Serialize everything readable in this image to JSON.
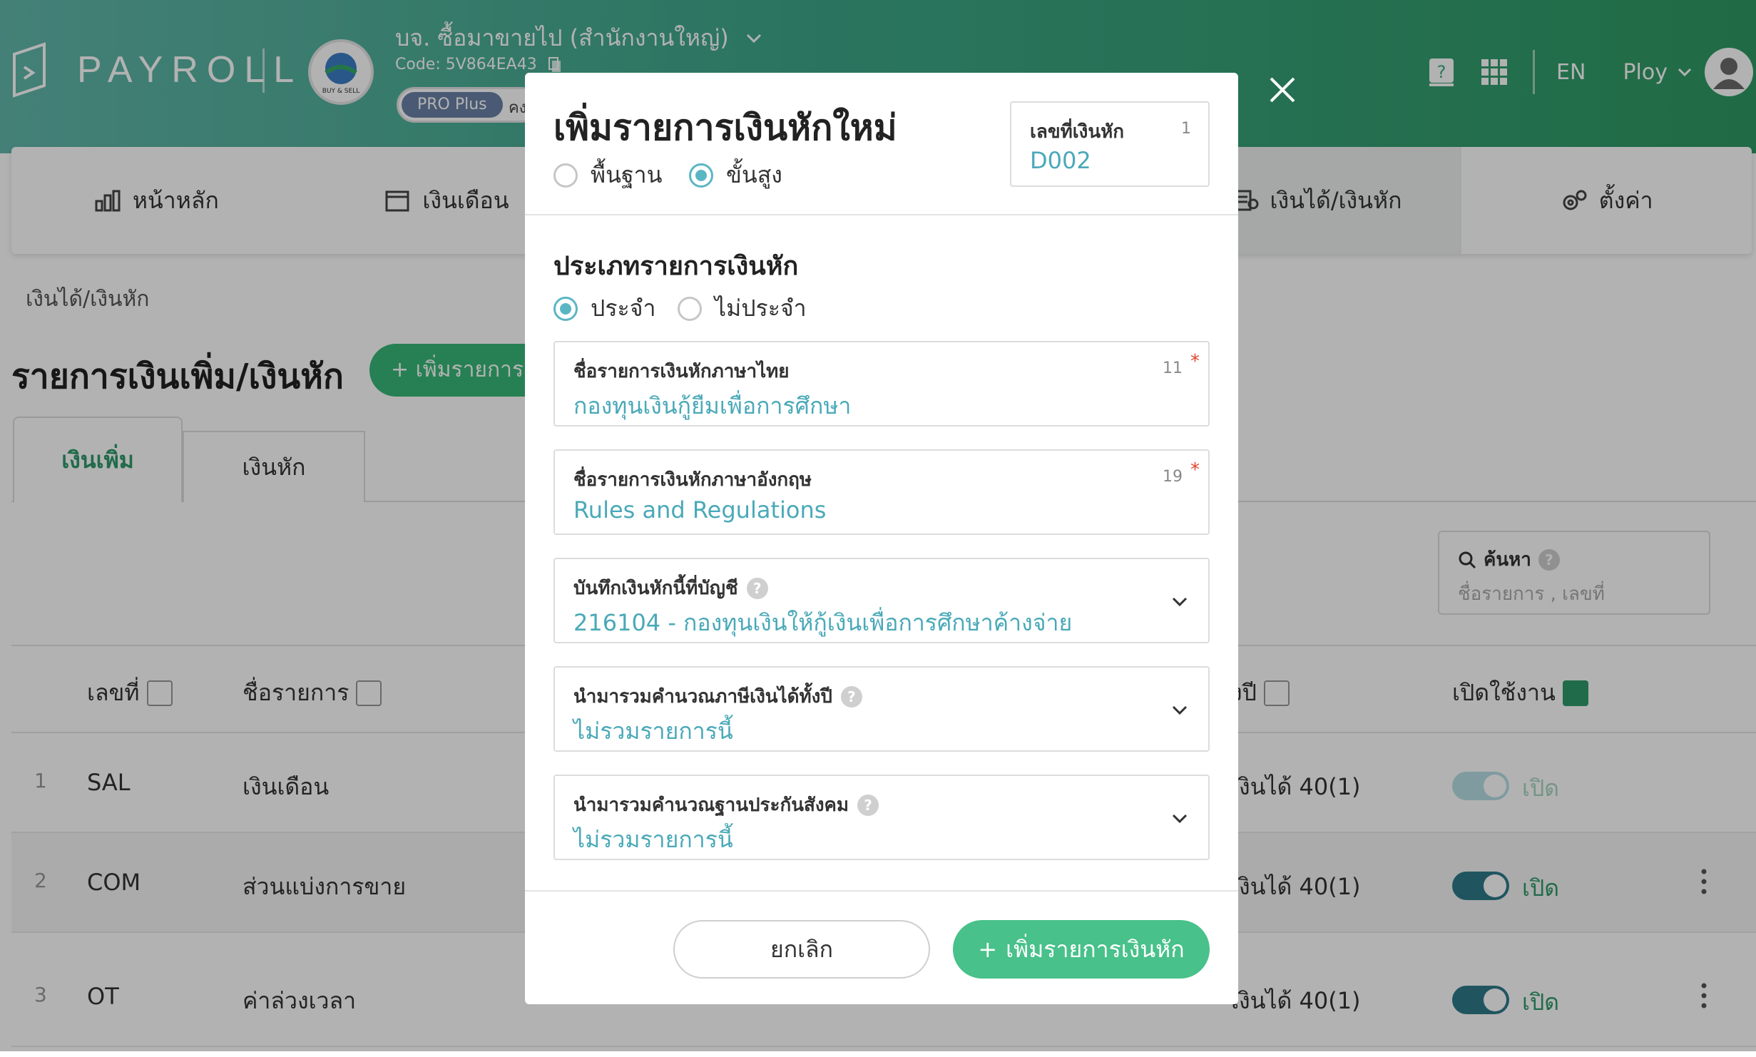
{
  "header": {
    "logo_text": "PAYROLL",
    "company_name": "บจ. ซื้อมาขายไป (สำนักงานใหญ่)",
    "company_code": "Code: 5V864EA43",
    "company_logo_text": "BUY & SELL",
    "plan_badge": "PRO Plus",
    "plan_extra": "คง",
    "lang": "EN",
    "user_name": "Ploy"
  },
  "nav": {
    "items": [
      {
        "label": "หน้าหลัก",
        "icon": "chart-bar-icon"
      },
      {
        "label": "เงินเดือน",
        "icon": "calendar-icon"
      },
      {
        "label": "",
        "icon": ""
      },
      {
        "label": "",
        "icon": ""
      },
      {
        "label": "เงินได้/เงินหัก",
        "icon": "money-stack-icon"
      },
      {
        "label": "ตั้งค่า",
        "icon": "gears-icon"
      }
    ]
  },
  "page": {
    "breadcrumb": "เงินได้/เงินหัก",
    "title": "รายการเงินเพิ่ม/เงินหัก",
    "add_button": "+ เพิ่มรายการเ",
    "tabs": [
      "เงินเพิ่ม",
      "เงินหัก"
    ],
    "search_label": "ค้นหา",
    "search_placeholder": "ชื่อรายการ , เลขที่",
    "columns": [
      "เลขที่",
      "ชื่อรายการ",
      "ั้งปี",
      "เปิดใช้งาน"
    ],
    "rows": [
      {
        "num": "1",
        "code": "SAL",
        "name": "เงินเดือน",
        "tax": "เงินได้ 40(1)",
        "status": "เปิด",
        "enabled": true
      },
      {
        "num": "2",
        "code": "COM",
        "name": "ส่วนแบ่งการขาย",
        "tax": "เงินได้ 40(1)",
        "status": "เปิด",
        "enabled": true
      },
      {
        "num": "3",
        "code": "OT",
        "name": "ค่าล่วงเวลา",
        "tax": "เงินได้ 40(1)",
        "status": "เปิด",
        "enabled": true
      }
    ]
  },
  "modal": {
    "title": "เพิ่มรายการเงินหักใหม่",
    "mode_options": [
      {
        "label": "พื้นฐาน",
        "selected": false
      },
      {
        "label": "ขั้นสูง",
        "selected": true
      }
    ],
    "code_field": {
      "label": "เลขที่เงินหัก",
      "count": "1",
      "value": "D002"
    },
    "type_section_title": "ประเภทรายการเงินหัก",
    "type_options": [
      {
        "label": "ประจำ",
        "selected": true
      },
      {
        "label": "ไม่ประจำ",
        "selected": false
      }
    ],
    "name_th": {
      "label": "ชื่อรายการเงินหักภาษาไทย",
      "count": "11",
      "required": "*",
      "value": "กองทุนเงินกู้ยืมเพื่อการศึกษา"
    },
    "name_en": {
      "label": "ชื่อรายการเงินหักภาษาอังกฤษ",
      "count": "19",
      "required": "*",
      "value": "Rules and Regulations"
    },
    "account": {
      "label": "บันทึกเงินหักนี้ที่บัญชี",
      "value": "216104 - กองทุนเงินให้กู้เงินเพื่อการศึกษาค้างจ่าย"
    },
    "tax_calc": {
      "label": "นำมารวมคำนวณภาษีเงินได้ทั้งปี",
      "value": "ไม่รวมรายการนี้"
    },
    "sso_calc": {
      "label": "นำมารวมคำนวณฐานประกันสังคม",
      "value": "ไม่รวมรายการนี้"
    },
    "cancel_button": "ยกเลิก",
    "submit_button": "เพิ่มรายการเงินหัก",
    "submit_prefix": "+"
  },
  "colors": {
    "primary": "#48c18a",
    "accent": "#5bb6c4",
    "required": "#e0452b"
  }
}
